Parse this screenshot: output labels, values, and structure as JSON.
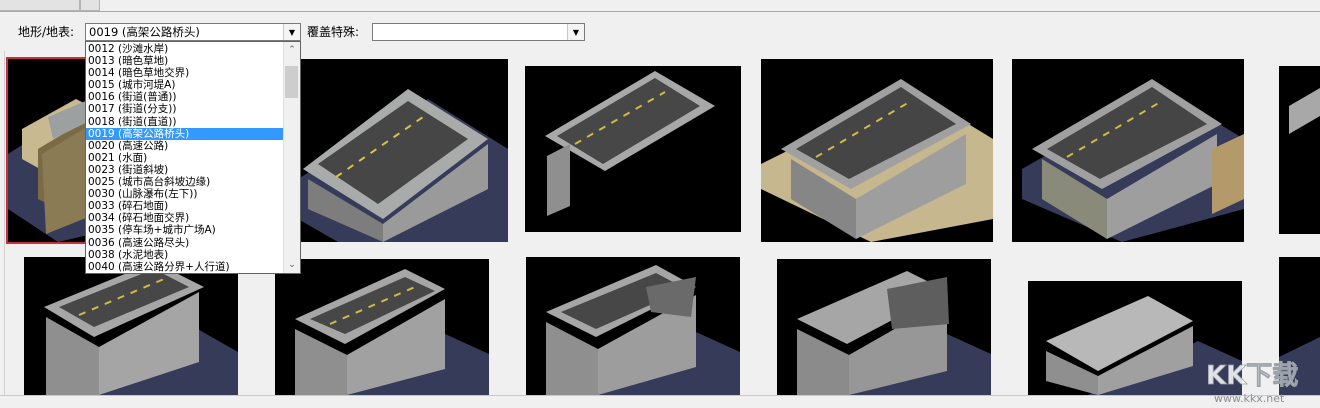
{
  "toolbar": {
    "terrain_label": "地形/地表:",
    "terrain_value": "0019 (高架公路桥头)",
    "overlay_label": "覆盖特殊:",
    "overlay_value": ""
  },
  "terrain_list": {
    "items": [
      "0012 (沙滩水岸)",
      "0013 (暗色草地)",
      "0014 (暗色草地交界)",
      "0015 (城市河堤A)",
      "0016 (街道(普通))",
      "0017 (街道(分支))",
      "0018 (街道(直道))",
      "0019 (高架公路桥头)",
      "0020 (高速公路)",
      "0021 (水面)",
      "0023 (街道斜坡)",
      "0025 (城市高台斜坡边缘)",
      "0030 (山脉瀑布(左下))",
      "0033 (碎石地面)",
      "0034 (碎石地面交界)",
      "0035 (停车场+城市广场A)",
      "0036 (高速公路尽头)",
      "0038 (水泥地表)",
      "0040 (高速公路分界+人行道)"
    ],
    "selected_index": 7
  },
  "tiles": {
    "selected_index": 0,
    "row1": [
      {
        "variant": "bridge-end-side"
      },
      {
        "variant": "bridge-large"
      },
      {
        "variant": "bridge-thin-pier"
      },
      {
        "variant": "bridge-sand-base"
      },
      {
        "variant": "bridge-sand-base-right"
      },
      {
        "variant": "bridge-partial"
      }
    ],
    "row2": [
      {
        "variant": "wall-intact"
      },
      {
        "variant": "wall-damaged-1"
      },
      {
        "variant": "wall-damaged-2"
      },
      {
        "variant": "wall-damaged-3"
      },
      {
        "variant": "wall-rubble"
      },
      {
        "variant": "wall-partial"
      }
    ]
  },
  "watermark": {
    "brand": "KK下载",
    "url": "www.kkx.net"
  },
  "colors": {
    "selection": "#3399ff",
    "tile_highlight": "#c8303c"
  }
}
